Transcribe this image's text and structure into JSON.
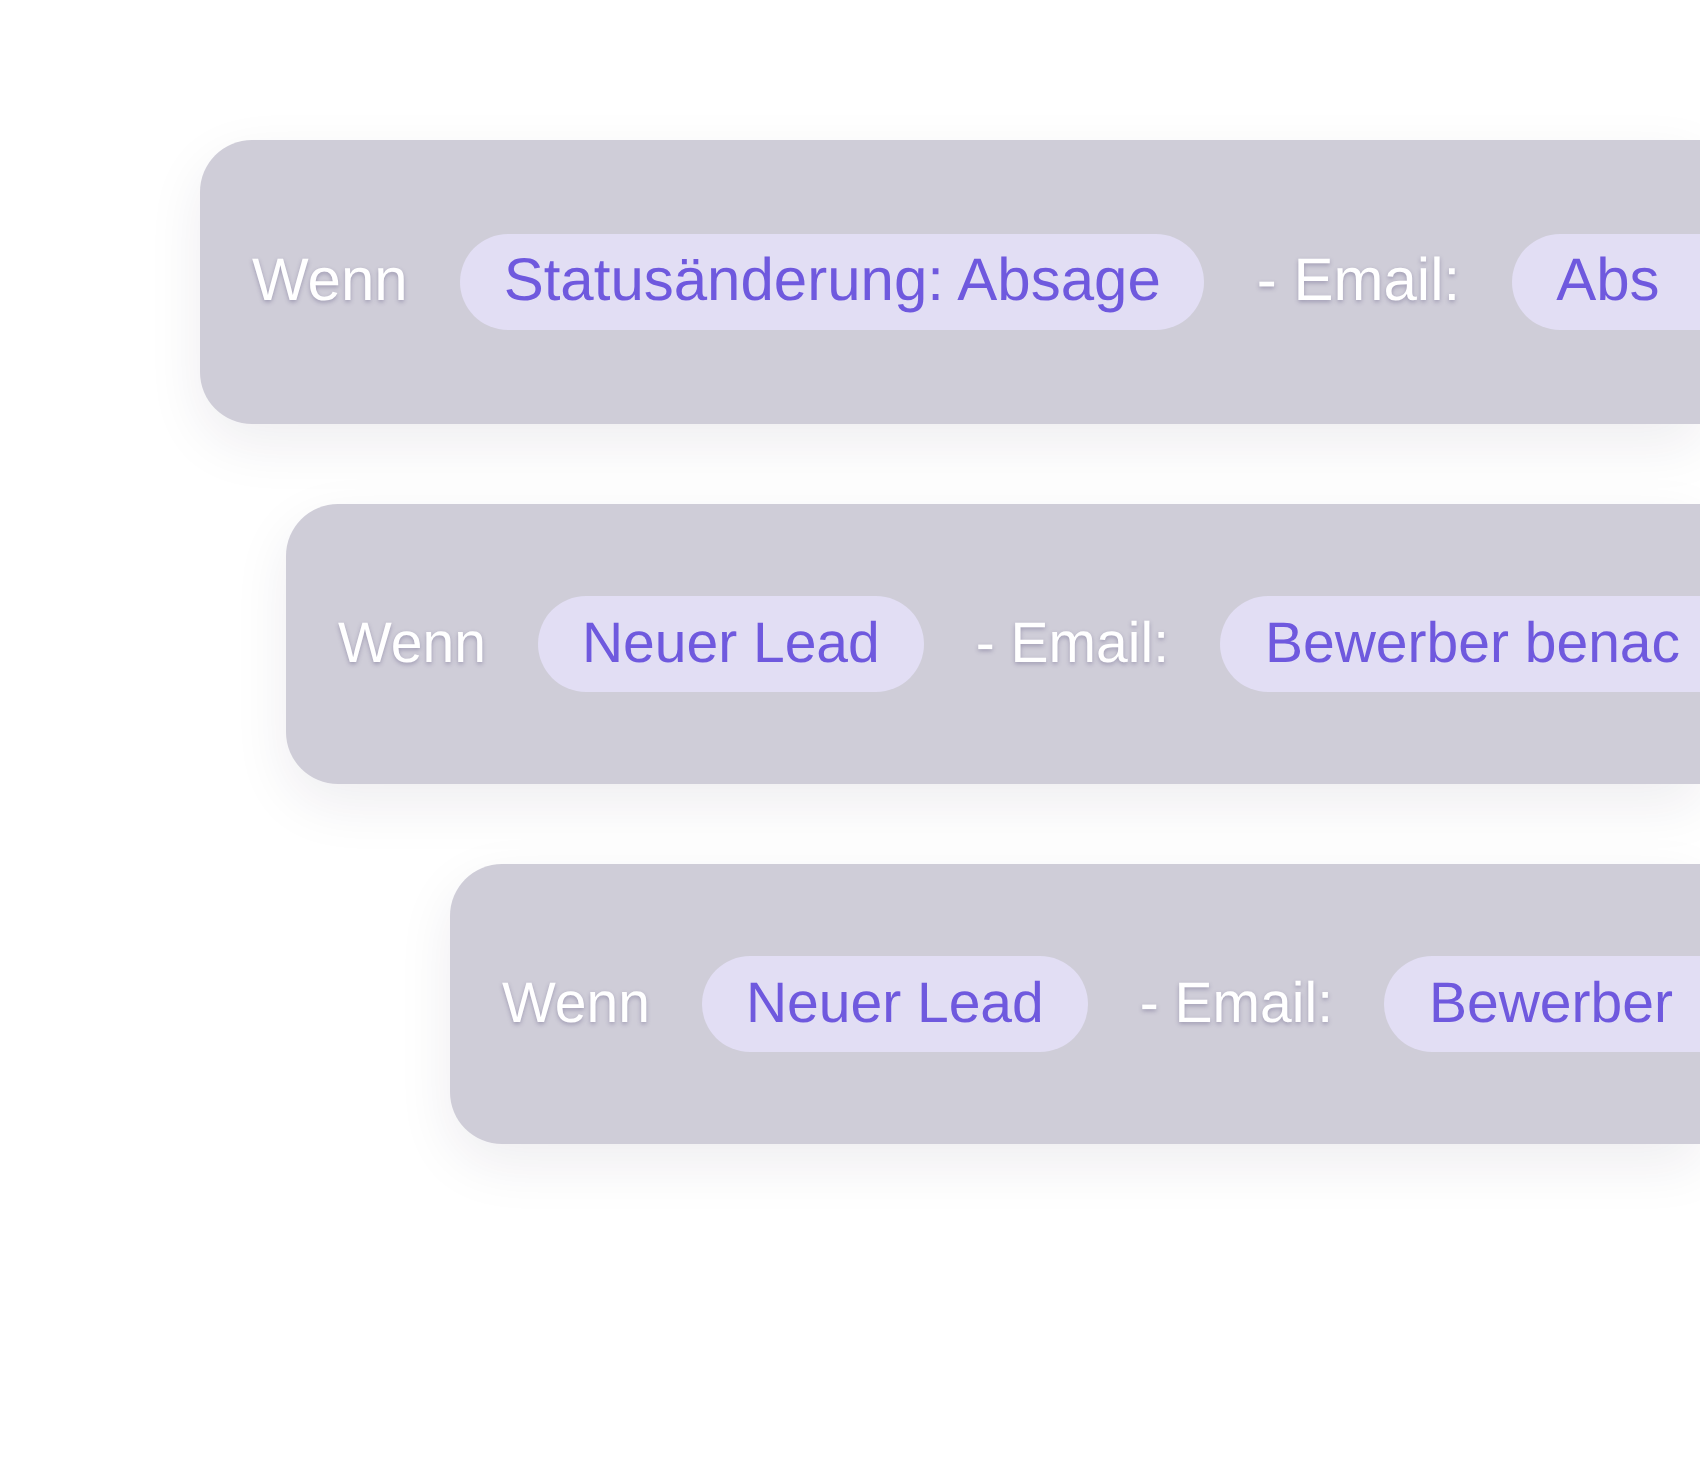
{
  "rules": [
    {
      "condition_label": "Wenn",
      "trigger": "Statusänderung: Absage",
      "action_label": "- Email:",
      "email_template": "Abs"
    },
    {
      "condition_label": "Wenn",
      "trigger": "Neuer Lead",
      "action_label": "- Email:",
      "email_template": "Bewerber benac"
    },
    {
      "condition_label": "Wenn",
      "trigger": "Neuer Lead",
      "action_label": "- Email:",
      "email_template": "Bewerber"
    }
  ]
}
